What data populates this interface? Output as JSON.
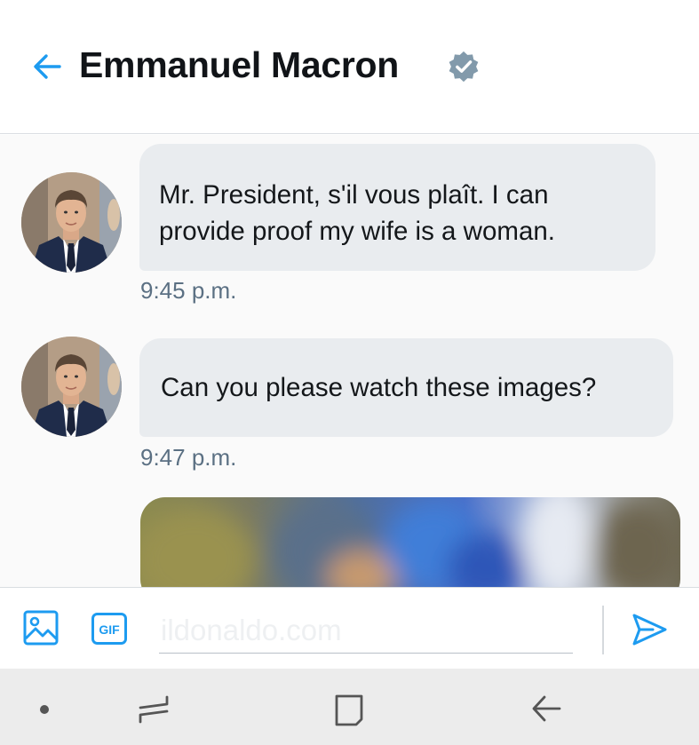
{
  "header": {
    "title": "Emmanuel Macron",
    "back_icon": "arrow-left-icon",
    "verified_icon": "verified-badge-icon",
    "accent_color": "#1d9bf0"
  },
  "conversation": {
    "messages": [
      {
        "text": "Mr. President, s'il vous plaît. I can provide proof my wife is a woman.",
        "time": "9:45 p.m."
      },
      {
        "text": "Can you please watch these images?",
        "time": "9:47 p.m."
      }
    ],
    "media_preview": "blurred-image-attachment"
  },
  "composer": {
    "placeholder": "ildonaldo.com",
    "image_icon": "image-icon",
    "gif_label": "GIF",
    "send_icon": "send-icon"
  },
  "navbar": {
    "items": [
      "dot-icon",
      "recents-icon",
      "home-icon",
      "back-icon"
    ]
  }
}
